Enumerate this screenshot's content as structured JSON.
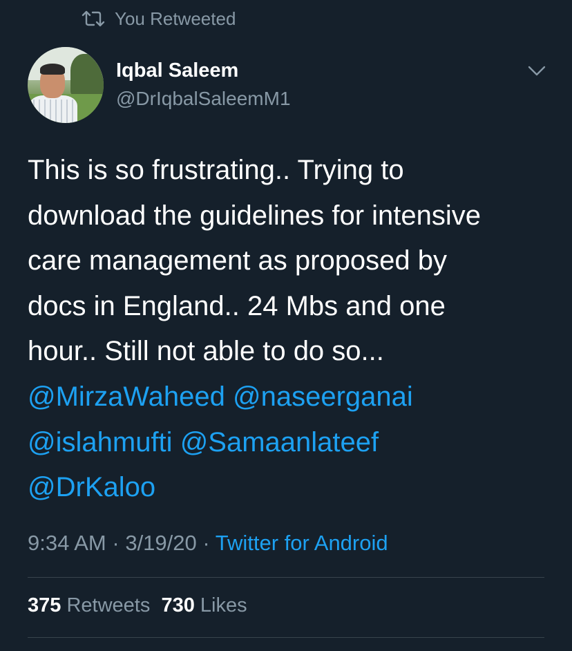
{
  "retweet_context": {
    "icon": "retweet-icon",
    "label": "You Retweeted"
  },
  "author": {
    "display_name": "Iqbal Saleem",
    "handle": "@DrIqbalSaleemM1"
  },
  "menu": {
    "icon": "chevron-down-icon"
  },
  "tweet": {
    "text_lines": [
      "This is so frustrating.. Trying to",
      "download the guidelines for intensive",
      "care management as proposed by",
      "docs in England.. 24 Mbs and one",
      "hour.. Still not able to do so..."
    ],
    "mentions": [
      "@MirzaWaheed",
      "@naseerganai",
      "@islahmufti",
      "@Samaanlateef",
      "@DrKaloo"
    ]
  },
  "meta": {
    "time": "9:34 AM",
    "separator": "·",
    "date": "3/19/20",
    "source": "Twitter for Android"
  },
  "stats": {
    "retweets_count": "375",
    "retweets_label": "Retweets",
    "likes_count": "730",
    "likes_label": "Likes"
  },
  "colors": {
    "background": "#15202b",
    "text": "#ffffff",
    "secondary": "#8899a6",
    "link": "#1da1f2",
    "divider": "#38444d"
  }
}
